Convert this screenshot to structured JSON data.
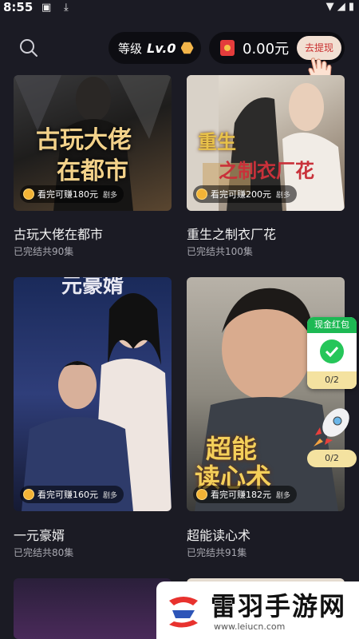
{
  "status_bar": {
    "time": "8:55"
  },
  "header": {
    "level_label": "等级",
    "level_value": "Lv.0",
    "balance": "0.00元",
    "withdraw_label": "去提现"
  },
  "dramas": [
    {
      "title": "古玩大佬在都市",
      "episodes": "已完结共90集",
      "reward": "看完可赚180元",
      "more": "剧多",
      "poster_text": [
        "古玩大佬",
        "在都市"
      ]
    },
    {
      "title": "重生之制衣厂花",
      "episodes": "已完结共100集",
      "reward": "看完可赚200元",
      "more": "剧多",
      "poster_text": [
        "重生",
        "之制衣厂花"
      ]
    },
    {
      "title": "一元豪婿",
      "episodes": "已完结共80集",
      "reward": "看完可赚160元",
      "more": "剧多",
      "poster_text": [
        "元豪婿"
      ]
    },
    {
      "title": "超能读心术",
      "episodes": "已完结共91集",
      "reward": "看完可赚182元",
      "more": "剧多",
      "poster_text": [
        "超能",
        "读心术"
      ]
    }
  ],
  "floating": {
    "cash_label": "现金红包",
    "cash_progress": "0/2",
    "rocket_progress": "0/2"
  },
  "watermark": {
    "name": "雷羽手游网",
    "url": "www.leiucn.com"
  },
  "colors": {
    "background": "#1b1b24",
    "accent_gold": "#f2b336",
    "reward_red": "#c93030"
  }
}
